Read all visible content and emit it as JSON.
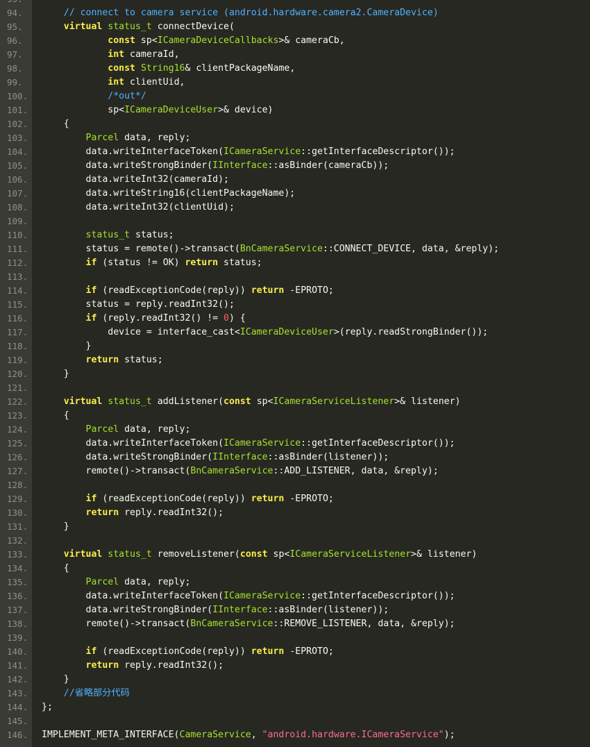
{
  "colors": {
    "background": "#272822",
    "gutter": "#3a3b35",
    "line_number": "#8f908a",
    "text": "#f8f8f2",
    "keyword": "#f9ee4a",
    "type": "#a6e22e",
    "comment": "#4fb3ff",
    "number": "#ff5f5f",
    "string": "#ff6b8b"
  },
  "lines": [
    {
      "num": "93.",
      "tokens": []
    },
    {
      "num": "94.",
      "tokens": [
        {
          "t": "    "
        },
        {
          "t": "// connect to camera service (android.hardware.camera2.CameraDevice)",
          "c": "com"
        }
      ]
    },
    {
      "num": "95.",
      "tokens": [
        {
          "t": "    "
        },
        {
          "t": "virtual",
          "c": "kw"
        },
        {
          "t": " "
        },
        {
          "t": "status_t",
          "c": "ty"
        },
        {
          "t": " connectDevice("
        }
      ]
    },
    {
      "num": "96.",
      "tokens": [
        {
          "t": "            "
        },
        {
          "t": "const",
          "c": "kw"
        },
        {
          "t": " sp<"
        },
        {
          "t": "ICameraDeviceCallbacks",
          "c": "ty"
        },
        {
          "t": ">& cameraCb,"
        }
      ]
    },
    {
      "num": "97.",
      "tokens": [
        {
          "t": "            "
        },
        {
          "t": "int",
          "c": "kw"
        },
        {
          "t": " cameraId,"
        }
      ]
    },
    {
      "num": "98.",
      "tokens": [
        {
          "t": "            "
        },
        {
          "t": "const",
          "c": "kw"
        },
        {
          "t": " "
        },
        {
          "t": "String16",
          "c": "ty"
        },
        {
          "t": "& clientPackageName,"
        }
      ]
    },
    {
      "num": "99.",
      "tokens": [
        {
          "t": "            "
        },
        {
          "t": "int",
          "c": "kw"
        },
        {
          "t": " clientUid,"
        }
      ]
    },
    {
      "num": "100.",
      "tokens": [
        {
          "t": "            "
        },
        {
          "t": "/*out*/",
          "c": "com"
        }
      ]
    },
    {
      "num": "101.",
      "tokens": [
        {
          "t": "            sp<"
        },
        {
          "t": "ICameraDeviceUser",
          "c": "ty"
        },
        {
          "t": ">& device)"
        }
      ]
    },
    {
      "num": "102.",
      "tokens": [
        {
          "t": "    {"
        }
      ]
    },
    {
      "num": "103.",
      "tokens": [
        {
          "t": "        "
        },
        {
          "t": "Parcel",
          "c": "ty"
        },
        {
          "t": " data, reply;"
        }
      ]
    },
    {
      "num": "104.",
      "tokens": [
        {
          "t": "        data.writeInterfaceToken("
        },
        {
          "t": "ICameraService",
          "c": "ty"
        },
        {
          "t": "::getInterfaceDescriptor());"
        }
      ]
    },
    {
      "num": "105.",
      "tokens": [
        {
          "t": "        data.writeStrongBinder("
        },
        {
          "t": "IInterface",
          "c": "ty"
        },
        {
          "t": "::asBinder(cameraCb));"
        }
      ]
    },
    {
      "num": "106.",
      "tokens": [
        {
          "t": "        data.writeInt32(cameraId);"
        }
      ]
    },
    {
      "num": "107.",
      "tokens": [
        {
          "t": "        data.writeString16(clientPackageName);"
        }
      ]
    },
    {
      "num": "108.",
      "tokens": [
        {
          "t": "        data.writeInt32(clientUid);"
        }
      ]
    },
    {
      "num": "109.",
      "tokens": []
    },
    {
      "num": "110.",
      "tokens": [
        {
          "t": "        "
        },
        {
          "t": "status_t",
          "c": "ty"
        },
        {
          "t": " status;"
        }
      ]
    },
    {
      "num": "111.",
      "tokens": [
        {
          "t": "        status = remote()->transact("
        },
        {
          "t": "BnCameraService",
          "c": "ty"
        },
        {
          "t": "::CONNECT_DEVICE, data, &reply);"
        }
      ]
    },
    {
      "num": "112.",
      "tokens": [
        {
          "t": "        "
        },
        {
          "t": "if",
          "c": "kw"
        },
        {
          "t": " (status != OK) "
        },
        {
          "t": "return",
          "c": "kw"
        },
        {
          "t": " status;"
        }
      ]
    },
    {
      "num": "113.",
      "tokens": []
    },
    {
      "num": "114.",
      "tokens": [
        {
          "t": "        "
        },
        {
          "t": "if",
          "c": "kw"
        },
        {
          "t": " (readExceptionCode(reply)) "
        },
        {
          "t": "return",
          "c": "kw"
        },
        {
          "t": " -EPROTO;"
        }
      ]
    },
    {
      "num": "115.",
      "tokens": [
        {
          "t": "        status = reply.readInt32();"
        }
      ]
    },
    {
      "num": "116.",
      "tokens": [
        {
          "t": "        "
        },
        {
          "t": "if",
          "c": "kw"
        },
        {
          "t": " (reply.readInt32() != "
        },
        {
          "t": "0",
          "c": "num"
        },
        {
          "t": ") {"
        }
      ]
    },
    {
      "num": "117.",
      "tokens": [
        {
          "t": "            device = interface_cast<"
        },
        {
          "t": "ICameraDeviceUser",
          "c": "ty"
        },
        {
          "t": ">(reply.readStrongBinder());"
        }
      ]
    },
    {
      "num": "118.",
      "tokens": [
        {
          "t": "        }"
        }
      ]
    },
    {
      "num": "119.",
      "tokens": [
        {
          "t": "        "
        },
        {
          "t": "return",
          "c": "kw"
        },
        {
          "t": " status;"
        }
      ]
    },
    {
      "num": "120.",
      "tokens": [
        {
          "t": "    }"
        }
      ]
    },
    {
      "num": "121.",
      "tokens": []
    },
    {
      "num": "122.",
      "tokens": [
        {
          "t": "    "
        },
        {
          "t": "virtual",
          "c": "kw"
        },
        {
          "t": " "
        },
        {
          "t": "status_t",
          "c": "ty"
        },
        {
          "t": " addListener("
        },
        {
          "t": "const",
          "c": "kw"
        },
        {
          "t": " sp<"
        },
        {
          "t": "ICameraServiceListener",
          "c": "ty"
        },
        {
          "t": ">& listener)"
        }
      ]
    },
    {
      "num": "123.",
      "tokens": [
        {
          "t": "    {"
        }
      ]
    },
    {
      "num": "124.",
      "tokens": [
        {
          "t": "        "
        },
        {
          "t": "Parcel",
          "c": "ty"
        },
        {
          "t": " data, reply;"
        }
      ]
    },
    {
      "num": "125.",
      "tokens": [
        {
          "t": "        data.writeInterfaceToken("
        },
        {
          "t": "ICameraService",
          "c": "ty"
        },
        {
          "t": "::getInterfaceDescriptor());"
        }
      ]
    },
    {
      "num": "126.",
      "tokens": [
        {
          "t": "        data.writeStrongBinder("
        },
        {
          "t": "IInterface",
          "c": "ty"
        },
        {
          "t": "::asBinder(listener));"
        }
      ]
    },
    {
      "num": "127.",
      "tokens": [
        {
          "t": "        remote()->transact("
        },
        {
          "t": "BnCameraService",
          "c": "ty"
        },
        {
          "t": "::ADD_LISTENER, data, &reply);"
        }
      ]
    },
    {
      "num": "128.",
      "tokens": []
    },
    {
      "num": "129.",
      "tokens": [
        {
          "t": "        "
        },
        {
          "t": "if",
          "c": "kw"
        },
        {
          "t": " (readExceptionCode(reply)) "
        },
        {
          "t": "return",
          "c": "kw"
        },
        {
          "t": " -EPROTO;"
        }
      ]
    },
    {
      "num": "130.",
      "tokens": [
        {
          "t": "        "
        },
        {
          "t": "return",
          "c": "kw"
        },
        {
          "t": " reply.readInt32();"
        }
      ]
    },
    {
      "num": "131.",
      "tokens": [
        {
          "t": "    }"
        }
      ]
    },
    {
      "num": "132.",
      "tokens": []
    },
    {
      "num": "133.",
      "tokens": [
        {
          "t": "    "
        },
        {
          "t": "virtual",
          "c": "kw"
        },
        {
          "t": " "
        },
        {
          "t": "status_t",
          "c": "ty"
        },
        {
          "t": " removeListener("
        },
        {
          "t": "const",
          "c": "kw"
        },
        {
          "t": " sp<"
        },
        {
          "t": "ICameraServiceListener",
          "c": "ty"
        },
        {
          "t": ">& listener)"
        }
      ]
    },
    {
      "num": "134.",
      "tokens": [
        {
          "t": "    {"
        }
      ]
    },
    {
      "num": "135.",
      "tokens": [
        {
          "t": "        "
        },
        {
          "t": "Parcel",
          "c": "ty"
        },
        {
          "t": " data, reply;"
        }
      ]
    },
    {
      "num": "136.",
      "tokens": [
        {
          "t": "        data.writeInterfaceToken("
        },
        {
          "t": "ICameraService",
          "c": "ty"
        },
        {
          "t": "::getInterfaceDescriptor());"
        }
      ]
    },
    {
      "num": "137.",
      "tokens": [
        {
          "t": "        data.writeStrongBinder("
        },
        {
          "t": "IInterface",
          "c": "ty"
        },
        {
          "t": "::asBinder(listener));"
        }
      ]
    },
    {
      "num": "138.",
      "tokens": [
        {
          "t": "        remote()->transact("
        },
        {
          "t": "BnCameraService",
          "c": "ty"
        },
        {
          "t": "::REMOVE_LISTENER, data, &reply);"
        }
      ]
    },
    {
      "num": "139.",
      "tokens": []
    },
    {
      "num": "140.",
      "tokens": [
        {
          "t": "        "
        },
        {
          "t": "if",
          "c": "kw"
        },
        {
          "t": " (readExceptionCode(reply)) "
        },
        {
          "t": "return",
          "c": "kw"
        },
        {
          "t": " -EPROTO;"
        }
      ]
    },
    {
      "num": "141.",
      "tokens": [
        {
          "t": "        "
        },
        {
          "t": "return",
          "c": "kw"
        },
        {
          "t": " reply.readInt32();"
        }
      ]
    },
    {
      "num": "142.",
      "tokens": [
        {
          "t": "    }"
        }
      ]
    },
    {
      "num": "143.",
      "tokens": [
        {
          "t": "    "
        },
        {
          "t": "//省略部分代码",
          "c": "com"
        }
      ]
    },
    {
      "num": "144.",
      "tokens": [
        {
          "t": "};"
        }
      ]
    },
    {
      "num": "145.",
      "tokens": []
    },
    {
      "num": "146.",
      "tokens": [
        {
          "t": "IMPLEMENT_META_INTERFACE("
        },
        {
          "t": "CameraService",
          "c": "ty"
        },
        {
          "t": ", "
        },
        {
          "t": "\"android.hardware.ICameraService\"",
          "c": "str"
        },
        {
          "t": ");"
        }
      ]
    }
  ]
}
